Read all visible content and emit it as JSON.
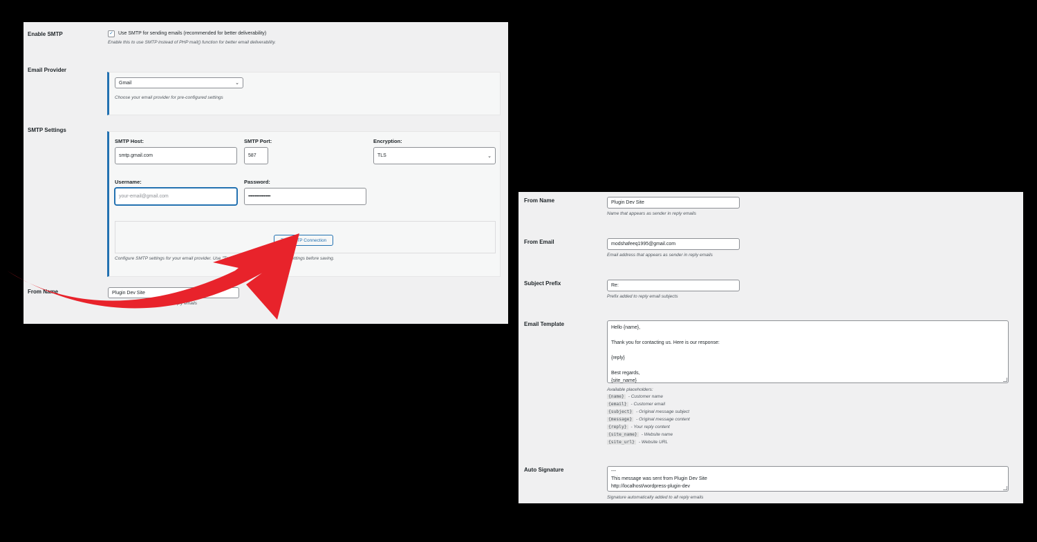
{
  "left": {
    "enable_smtp": {
      "label": "Enable SMTP",
      "checkbox_label": "Use SMTP for sending emails (recommended for better deliverability)",
      "checked": true,
      "description": "Enable this to use SMTP instead of PHP mail() function for better email deliverability."
    },
    "email_provider": {
      "label": "Email Provider",
      "selected": "Gmail",
      "description": "Choose your email provider for pre-configured settings"
    },
    "smtp_settings": {
      "label": "SMTP Settings",
      "host_label": "SMTP Host:",
      "host_value": "smtp.gmail.com",
      "port_label": "SMTP Port:",
      "port_value": "587",
      "encryption_label": "Encryption:",
      "encryption_value": "TLS",
      "username_label": "Username:",
      "username_placeholder": "your-email@gmail.com",
      "password_label": "Password:",
      "password_value": "••••••••••••••••••••",
      "test_button": "Test SMTP Connection",
      "description": "Configure SMTP settings for your email provider. Use \"Test SMTP Connection\" to verify settings before saving."
    },
    "from_name": {
      "label": "From Name",
      "value": "Plugin Dev Site",
      "description": "Name that appears as sender in reply emails"
    }
  },
  "right": {
    "from_name": {
      "label": "From Name",
      "value": "Plugin Dev Site",
      "description": "Name that appears as sender in reply emails"
    },
    "from_email": {
      "label": "From Email",
      "value": "modshafeeq1995@gmail.com",
      "description": "Email address that appears as sender in reply emails"
    },
    "subject_prefix": {
      "label": "Subject Prefix",
      "value": "Re:",
      "description": "Prefix added to reply email subjects"
    },
    "email_template": {
      "label": "Email Template",
      "lines": [
        "Hello {name},",
        "",
        "Thank you for contacting us. Here is our response:",
        "",
        "{reply}",
        "",
        "Best regards,",
        "{site_name}"
      ],
      "placeholders_title": "Available placeholders:",
      "placeholders": [
        {
          "code": "{name}",
          "desc": "- Customer name"
        },
        {
          "code": "{email}",
          "desc": "- Customer email"
        },
        {
          "code": "{subject}",
          "desc": "- Original message subject"
        },
        {
          "code": "{message}",
          "desc": "- Original message content"
        },
        {
          "code": "{reply}",
          "desc": "- Your reply content"
        },
        {
          "code": "{site_name}",
          "desc": "- Website name"
        },
        {
          "code": "{site_url}",
          "desc": "- Website URL"
        }
      ]
    },
    "auto_signature": {
      "label": "Auto Signature",
      "lines": [
        "---",
        "This message was sent from Plugin Dev Site",
        "http://localhost/wordpress-plugin-dev"
      ],
      "description": "Signature automatically added to all reply emails"
    }
  },
  "colors": {
    "accent": "#2271b1",
    "arrow": "#e8232b",
    "panel_bg": "#f0f0f1"
  }
}
